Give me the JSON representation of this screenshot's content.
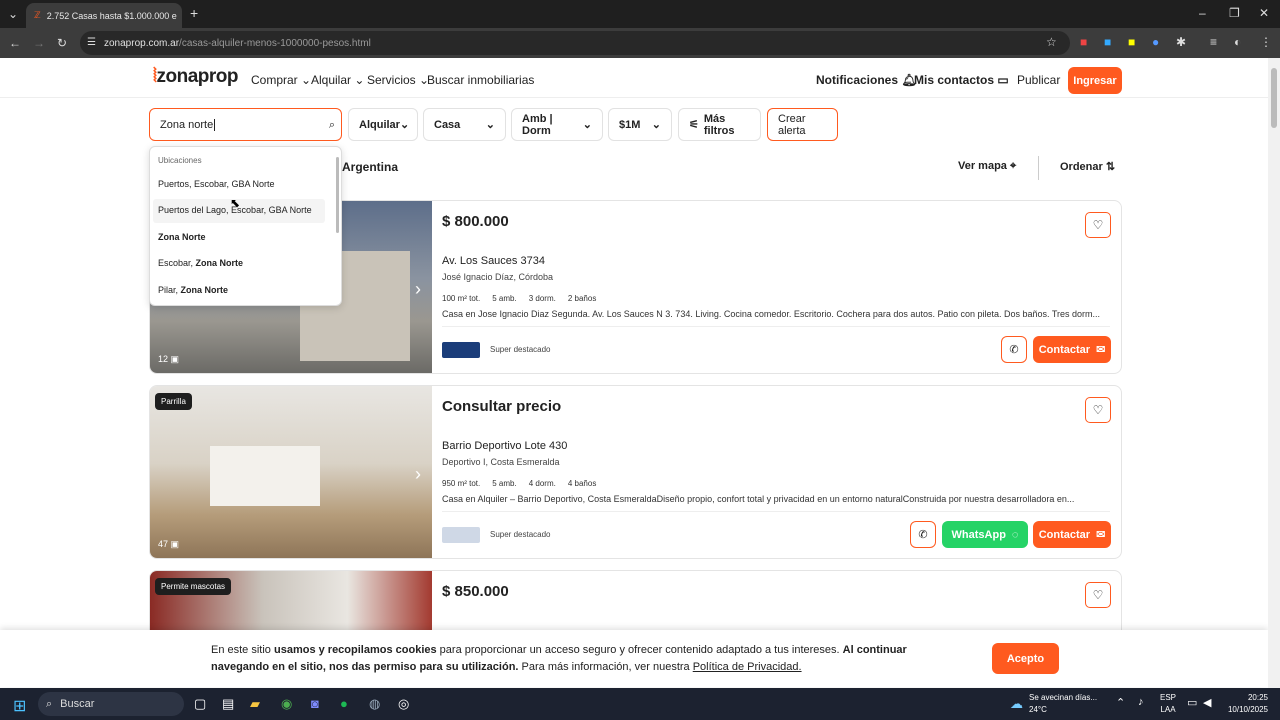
{
  "browser": {
    "tab_title": "2.752 Casas hasta $1.000.000 e",
    "url_host": "zonaprop.com.ar",
    "url_path": "/casas-alquiler-menos-1000000-pesos.html"
  },
  "header": {
    "logo": "zonaprop",
    "nav": [
      "Comprar",
      "Alquilar",
      "Servicios",
      "Buscar inmobiliarias"
    ],
    "notifications": "Notificaciones",
    "contacts": "Mis contactos",
    "publish": "Publicar",
    "login": "Ingresar"
  },
  "filters": {
    "search_value": "Zona norte",
    "operation": "Alquilar",
    "type": "Casa",
    "rooms": "Amb | Dorm",
    "price": "$1M",
    "more": "Más filtros",
    "alert": "Crear alerta"
  },
  "dropdown": {
    "heading": "Ubicaciones",
    "items": [
      {
        "pre": "Puertos, Escobar, GBA Norte",
        "bold": ""
      },
      {
        "pre": "Puertos del Lago, Escobar, GBA Norte",
        "bold": ""
      },
      {
        "pre": "",
        "bold": "Zona Norte"
      },
      {
        "pre": "Escobar, ",
        "bold": "Zona Norte"
      },
      {
        "pre": "Pilar, ",
        "bold": "Zona Norte"
      }
    ]
  },
  "results": {
    "title_fragment": "Argentina",
    "map": "Ver mapa",
    "order": "Ordenar"
  },
  "listings": [
    {
      "price": "$ 800.000",
      "address": "Av. Los Sauces 3734",
      "location": "José Ignacio Díaz, Córdoba",
      "features": [
        "100 m² tot.",
        "5 amb.",
        "3 dorm.",
        "2 baños"
      ],
      "description": "Casa en Jose Ignacio Diaz Segunda. Av. Los Sauces N 3. 734. Living. Cocina comedor. Escritorio. Cochera para dos autos. Patio con pileta. Dos baños. Tres dorm...",
      "tag": "Super destacado",
      "photos": "12",
      "contact": "Contactar",
      "badge": ""
    },
    {
      "price": "Consultar precio",
      "address": "Barrio Deportivo Lote 430",
      "location": "Deportivo I, Costa Esmeralda",
      "features": [
        "950 m² tot.",
        "5 amb.",
        "4 dorm.",
        "4 baños"
      ],
      "description": "Casa en Alquiler – Barrio Deportivo, Costa EsmeraldaDiseño propio, confort total y privacidad en un entorno naturalConstruida por nuestra desarrolladora en...",
      "tag": "Super destacado",
      "photos": "47",
      "contact": "Contactar",
      "whatsapp": "WhatsApp",
      "badge": "Parrilla"
    },
    {
      "price": "$ 850.000",
      "badge": "Permite mascotas"
    }
  ],
  "cookie": {
    "text1": "En este sitio ",
    "bold1": "usamos y recopilamos cookies",
    "text2": " para proporcionar un acceso seguro y ofrecer contenido adaptado a tus intereses. ",
    "bold2": "Al continuar navegando en el sitio, nos das permiso para su utilización.",
    "text3": " Para más información, ver nuestra ",
    "link": "Política de Privacidad.",
    "accept": "Acepto"
  },
  "taskbar": {
    "search": "Buscar",
    "weather_title": "Se avecinan días...",
    "weather_temp": "24°C",
    "lang1": "ESP",
    "lang2": "LAA",
    "time": "20:25",
    "date": "10/10/2025"
  },
  "colors": {
    "brand": "#ff5a1f",
    "whatsapp": "#25d366"
  }
}
